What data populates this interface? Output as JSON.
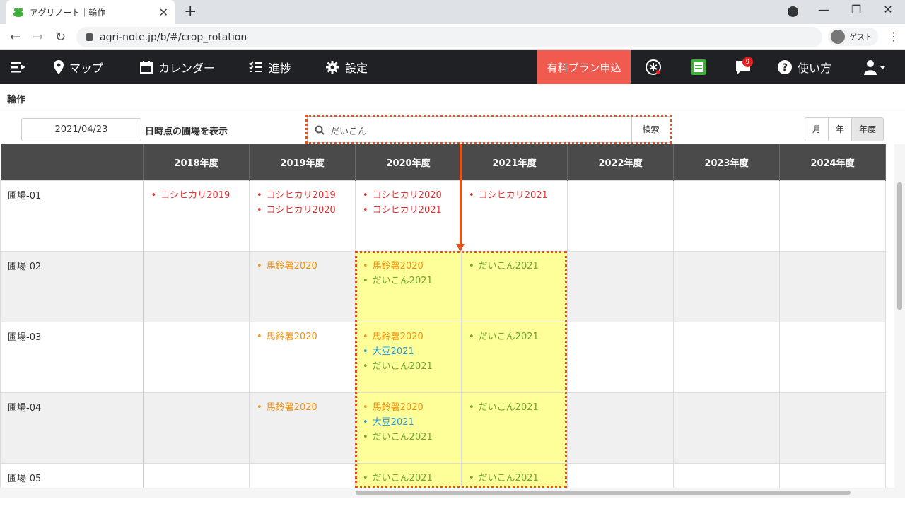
{
  "browser": {
    "tab_title": "アグリノート｜輪作",
    "url": "agri-note.jp/b/#/crop_rotation",
    "profile_label": "ゲスト"
  },
  "nav": {
    "map": "マップ",
    "calendar": "カレンダー",
    "progress": "進捗",
    "settings": "設定",
    "paid_plan": "有料プラン申込",
    "help": "使い方",
    "notification_count": "9"
  },
  "page": {
    "title": "輪作",
    "date_value": "2021/04/23",
    "date_suffix": "日時点の圃場を表示",
    "search_value": "だいこん",
    "search_button": "検索",
    "view_modes": [
      "月",
      "年",
      "年度"
    ],
    "selected_view_mode": "年度"
  },
  "table": {
    "years": [
      "2018年度",
      "2019年度",
      "2020年度",
      "2021年度",
      "2022年度",
      "2023年度",
      "2024年度"
    ],
    "rows": [
      {
        "field": "圃場-01",
        "cells": [
          [
            {
              "name": "コシヒカリ2019",
              "color": "red"
            }
          ],
          [
            {
              "name": "コシヒカリ2019",
              "color": "red"
            },
            {
              "name": "コシヒカリ2020",
              "color": "red"
            }
          ],
          [
            {
              "name": "コシヒカリ2020",
              "color": "red"
            },
            {
              "name": "コシヒカリ2021",
              "color": "red"
            }
          ],
          [
            {
              "name": "コシヒカリ2021",
              "color": "red"
            }
          ],
          [],
          [],
          []
        ]
      },
      {
        "field": "圃場-02",
        "cells": [
          [],
          [
            {
              "name": "馬鈴薯2020",
              "color": "orange"
            }
          ],
          [
            {
              "name": "馬鈴薯2020",
              "color": "orange"
            },
            {
              "name": "だいこん2021",
              "color": "green"
            }
          ],
          [
            {
              "name": "だいこん2021",
              "color": "green"
            }
          ],
          [],
          [],
          []
        ]
      },
      {
        "field": "圃場-03",
        "cells": [
          [],
          [
            {
              "name": "馬鈴薯2020",
              "color": "orange"
            }
          ],
          [
            {
              "name": "馬鈴薯2020",
              "color": "orange"
            },
            {
              "name": "大豆2021",
              "color": "blue"
            },
            {
              "name": "だいこん2021",
              "color": "green"
            }
          ],
          [
            {
              "name": "だいこん2021",
              "color": "green"
            }
          ],
          [],
          [],
          []
        ]
      },
      {
        "field": "圃場-04",
        "cells": [
          [],
          [
            {
              "name": "馬鈴薯2020",
              "color": "orange"
            }
          ],
          [
            {
              "name": "馬鈴薯2020",
              "color": "orange"
            },
            {
              "name": "大豆2021",
              "color": "blue"
            },
            {
              "name": "だいこん2021",
              "color": "green"
            }
          ],
          [
            {
              "name": "だいこん2021",
              "color": "green"
            }
          ],
          [],
          [],
          []
        ]
      },
      {
        "field": "圃場-05",
        "cells": [
          [],
          [],
          [
            {
              "name": "だいこん2021",
              "color": "green"
            }
          ],
          [
            {
              "name": "だいこん2021",
              "color": "green"
            }
          ],
          [],
          [],
          []
        ]
      }
    ]
  },
  "colors": {
    "nav_bg": "#1f2124",
    "paid_plan_bg": "#f15a4f",
    "highlight_fill": "#ffff99",
    "annotation": "#e8521a",
    "red": "#e53030",
    "orange": "#f0900e",
    "green": "#6aa632",
    "blue": "#1e9be0"
  }
}
